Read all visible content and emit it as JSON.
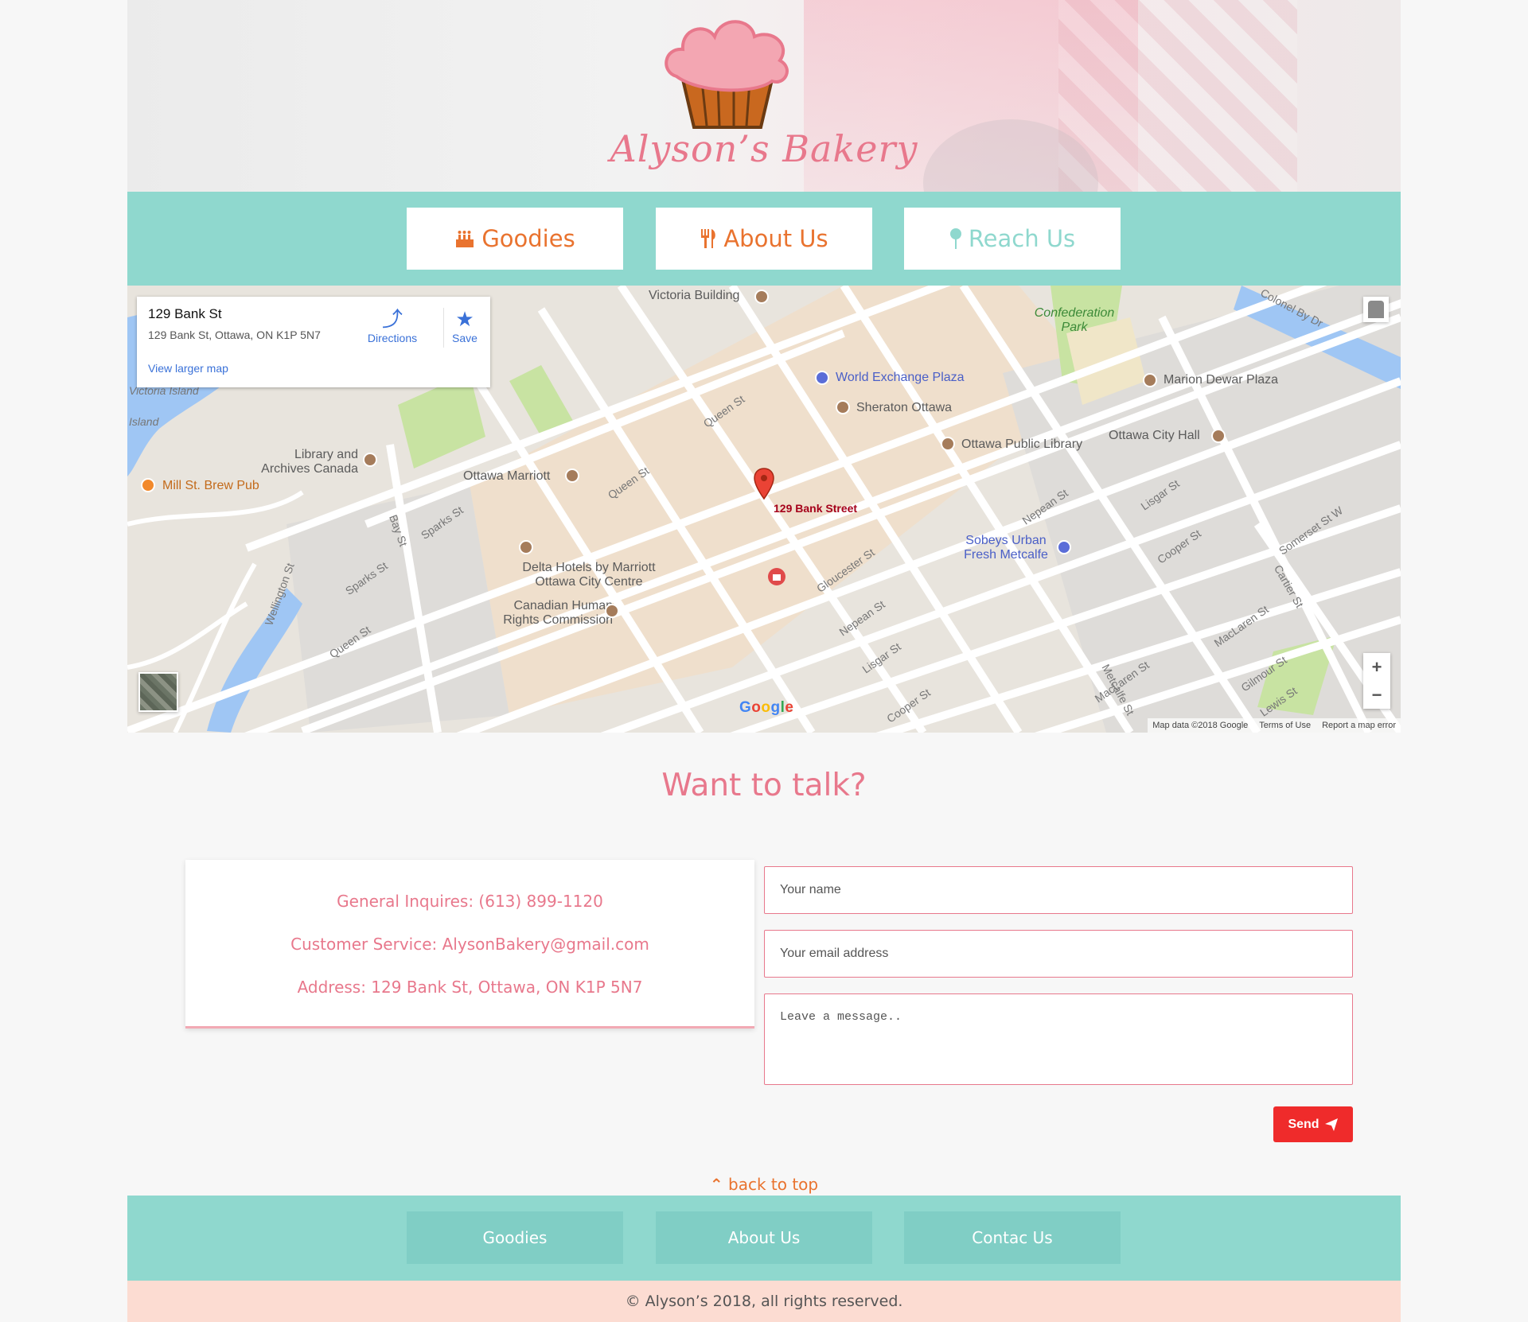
{
  "brand": {
    "name": "Alyson’s Bakery"
  },
  "nav": {
    "goodies": "Goodies",
    "about": "About Us",
    "reach": "Reach Us"
  },
  "map": {
    "place_title": "129 Bank St",
    "place_address": "129 Bank St, Ottawa, ON K1P 5N7",
    "directions": "Directions",
    "save": "Save",
    "view_larger": "View larger map",
    "pin_label": "129 Bank Street",
    "labels": {
      "victoria_building": "Victoria Building",
      "world_exchange": "World Exchange Plaza",
      "sheraton": "Sheraton Ottawa",
      "public_library": "Ottawa Public Library",
      "confederation": "Confederation Park",
      "marion_dewar": "Marion Dewar Plaza",
      "city_hall": "Ottawa City Hall",
      "marriott": "Ottawa Marriott",
      "library_archives": "Library and Archives Canada",
      "mill_st": "Mill St. Brew Pub",
      "victoria_island": "Victoria Island",
      "island": "Island",
      "delta": "Delta Hotels by Marriott Ottawa City Centre",
      "human_rights": "Canadian Human Rights Commission",
      "sobeys": "Sobeys Urban Fresh Metcalfe",
      "colonel_by": "Colonel By Dr",
      "queen_st": "Queen St",
      "sparks_st": "Sparks St",
      "bay_st": "Bay St",
      "wellington_st": "Wellington St",
      "gloucester_st": "Gloucester St",
      "nepean_st": "Nepean St",
      "lisgar_st": "Lisgar St",
      "cooper_st": "Cooper St",
      "maclaren_st": "MacLaren St",
      "somerset_st": "Somerset St W",
      "gilmour_st": "Gilmour St",
      "lewis_st": "Lewis St",
      "carter_st": "Cartier St",
      "metcalfe_st": "Metcalfe St"
    },
    "google": "Google",
    "footer_data": "Map data ©2018 Google",
    "footer_terms": "Terms of Use",
    "footer_report": "Report a map error",
    "zoom_in": "+",
    "zoom_out": "−"
  },
  "contact": {
    "heading": "Want to talk?",
    "general": "General Inquires: (613) 899-1120",
    "service": "Customer Service: AlysonBakery@gmail.com",
    "address": "Address: 129 Bank St, Ottawa, ON K1P 5N7",
    "name_placeholder": "Your name",
    "email_placeholder": "Your email address",
    "message_placeholder": "Leave a message..",
    "send": "Send"
  },
  "back_to_top": "back to top",
  "footer": {
    "goodies": "Goodies",
    "about": "About Us",
    "contact": "Contac Us",
    "copyright": "© Alyson’s 2018, all rights reserved."
  },
  "colors": {
    "accent_pink": "#e8788c",
    "accent_orange": "#e9732f",
    "teal": "#8fd8ce",
    "send_red": "#ef2b2b"
  }
}
